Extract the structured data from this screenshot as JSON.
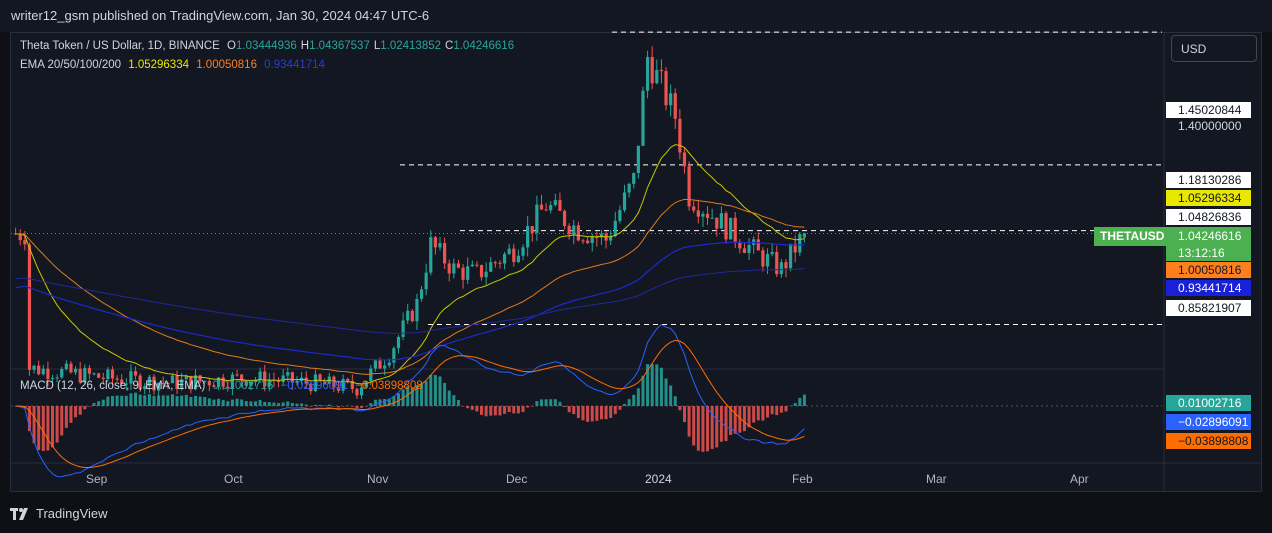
{
  "header": {
    "published_text": "writer12_gsm published on TradingView.com, Jan 30, 2024 04:47 UTC-6"
  },
  "legend": {
    "symbol_title": "Theta Token / US Dollar, 1D, BINANCE",
    "ohlc": [
      {
        "key": "O",
        "value": "1.03444936"
      },
      {
        "key": "H",
        "value": "1.04367537"
      },
      {
        "key": "L",
        "value": "1.02413852"
      },
      {
        "key": "C",
        "value": "1.04246616"
      }
    ],
    "ema_label": "EMA 20/50/100/200",
    "ema_values": [
      "1.05296334",
      "1.00050816",
      "0.93441714"
    ],
    "macd_label": "MACD (12, 26, close, 9, EMA, EMA)",
    "macd_values": [
      "0.01002716",
      "−0.02896091",
      "−0.03898808"
    ]
  },
  "currency_button": "USD",
  "price_axis": {
    "tags": [
      {
        "label": "1.45020844",
        "price": 1.45020844,
        "style": "plain"
      },
      {
        "label": "1.40000000",
        "price": 1.4,
        "style": "grid"
      },
      {
        "label": "1.18130286",
        "price": 1.18130286,
        "style": "plain"
      },
      {
        "label": "1.05296334",
        "price": 1.05296334,
        "style": "ema20"
      },
      {
        "label": "1.04826836",
        "price": 1.04826836,
        "style": "plain"
      },
      {
        "label": "1.04246616",
        "price": 1.04246616,
        "style": "last"
      },
      {
        "label": "13:12:16",
        "price": null,
        "style": "countdown"
      },
      {
        "label": "1.00050816",
        "price": 1.00050816,
        "style": "ema50"
      },
      {
        "label": "0.93441714",
        "price": 0.93441714,
        "style": "ema100"
      },
      {
        "label": "0.85821907",
        "price": 0.85821907,
        "style": "plain"
      }
    ],
    "symbol_tag": "THETAUSD",
    "macd_tags": [
      "0.01002716",
      "−0.02896091",
      "−0.03898808"
    ]
  },
  "time_axis": [
    "Sep",
    "Oct",
    "Nov",
    "Dec",
    "2024",
    "Feb",
    "Mar",
    "Apr"
  ],
  "footer": {
    "brand": "TradingView"
  },
  "colors": {
    "up": "#26a69a",
    "down": "#ef5350",
    "ema20": "#c8c800",
    "ema50": "#e07b1a",
    "ema100": "#1c2ac8",
    "ema200": "#1e2a9c",
    "macd": "#2962ff",
    "signal": "#ff6d00",
    "bg": "#131722"
  },
  "chart_data": {
    "type": "candlestick",
    "title": "Theta Token / US Dollar, 1D, BINANCE",
    "ohlc_last": {
      "open": 1.03444936,
      "high": 1.04367537,
      "low": 1.02413852,
      "close": 1.04246616
    },
    "x_range": [
      "2023-08-11",
      "2024-01-30"
    ],
    "close_series": [
      {
        "date": "2023-08-15",
        "close": 0.77
      },
      {
        "date": "2023-09-01",
        "close": 0.75
      },
      {
        "date": "2023-09-15",
        "close": 0.74
      },
      {
        "date": "2023-10-01",
        "close": 0.75
      },
      {
        "date": "2023-10-15",
        "close": 0.74
      },
      {
        "date": "2023-10-25",
        "close": 0.73
      },
      {
        "date": "2023-11-01",
        "close": 0.8
      },
      {
        "date": "2023-11-07",
        "close": 0.9
      },
      {
        "date": "2023-11-10",
        "close": 1.02
      },
      {
        "date": "2023-11-15",
        "close": 0.97
      },
      {
        "date": "2023-11-20",
        "close": 0.96
      },
      {
        "date": "2023-11-28",
        "close": 1.01
      },
      {
        "date": "2023-12-05",
        "close": 1.1
      },
      {
        "date": "2023-12-12",
        "close": 1.05
      },
      {
        "date": "2023-12-18",
        "close": 1.03
      },
      {
        "date": "2023-12-24",
        "close": 1.15
      },
      {
        "date": "2023-12-27",
        "close": 1.4
      },
      {
        "date": "2024-01-02",
        "close": 1.28
      },
      {
        "date": "2024-01-05",
        "close": 1.12
      },
      {
        "date": "2024-01-10",
        "close": 1.08
      },
      {
        "date": "2024-01-15",
        "close": 1.04
      },
      {
        "date": "2024-01-20",
        "close": 1.0
      },
      {
        "date": "2024-01-25",
        "close": 0.97
      },
      {
        "date": "2024-01-30",
        "close": 1.04246616
      }
    ],
    "horizontal_levels": [
      1.45020844,
      1.18130286,
      1.04826836,
      0.85821907
    ],
    "ema": {
      "20": 1.05296334,
      "50": 1.00050816,
      "100": 0.93441714
    },
    "macd": {
      "macd": 0.01002716,
      "signal": -0.02896091,
      "histogram": -0.03898808
    }
  }
}
